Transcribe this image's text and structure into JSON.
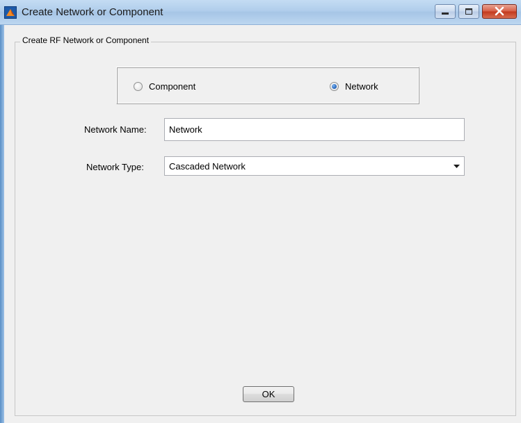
{
  "window": {
    "title": "Create Network or Component",
    "icon": "matlab-icon",
    "controls": {
      "minimize": "minimize-icon",
      "maximize": "maximize-icon",
      "close": "close-icon"
    }
  },
  "group": {
    "label": "Create RF Network or Component"
  },
  "mode": {
    "options": [
      {
        "label": "Component",
        "checked": false
      },
      {
        "label": "Network",
        "checked": true
      }
    ],
    "selected": "Network"
  },
  "form": {
    "name_label": "Network Name:",
    "name_value": "Network",
    "type_label": "Network Type:",
    "type_value": "Cascaded Network"
  },
  "footer": {
    "ok_label": "OK"
  },
  "colors": {
    "titlebar": "#b0cdeb",
    "background": "#f0f0f0",
    "close_button": "#c2381c",
    "radio_selected": "#2c6bc0"
  }
}
